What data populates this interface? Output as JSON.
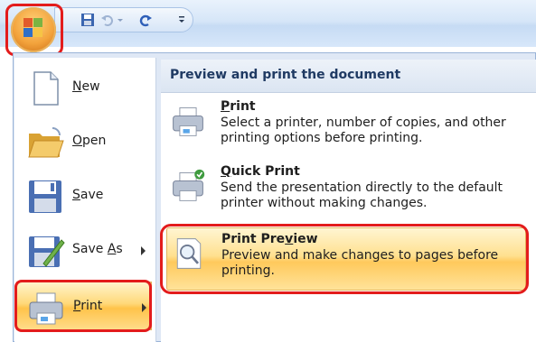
{
  "quick_access": {
    "save_icon": "save-icon",
    "undo_icon": "undo-icon",
    "redo_icon": "redo-icon",
    "customize_icon": "customize-qat-icon"
  },
  "menu": {
    "items": [
      {
        "label": "New",
        "icon": "new-document-icon"
      },
      {
        "label": "Open",
        "icon": "open-folder-icon"
      },
      {
        "label": "Save",
        "icon": "save-icon"
      },
      {
        "label": "Save As",
        "icon": "save-as-icon",
        "has_submenu": true
      },
      {
        "label": "Print",
        "icon": "printer-icon",
        "has_submenu": true,
        "active": true
      }
    ]
  },
  "submenu": {
    "header": "Preview and print the document",
    "items": [
      {
        "title": "Print",
        "desc": "Select a printer, number of copies, and other printing options before printing.",
        "icon": "printer-icon"
      },
      {
        "title": "Quick Print",
        "desc": "Send the presentation directly to the default printer without making changes.",
        "icon": "quick-print-icon"
      },
      {
        "title": "Print Preview",
        "desc": "Preview and make changes to pages before printing.",
        "icon": "print-preview-icon",
        "active": true
      }
    ]
  },
  "colors": {
    "highlight": "#e31c1c",
    "hover": "#ffd979"
  }
}
